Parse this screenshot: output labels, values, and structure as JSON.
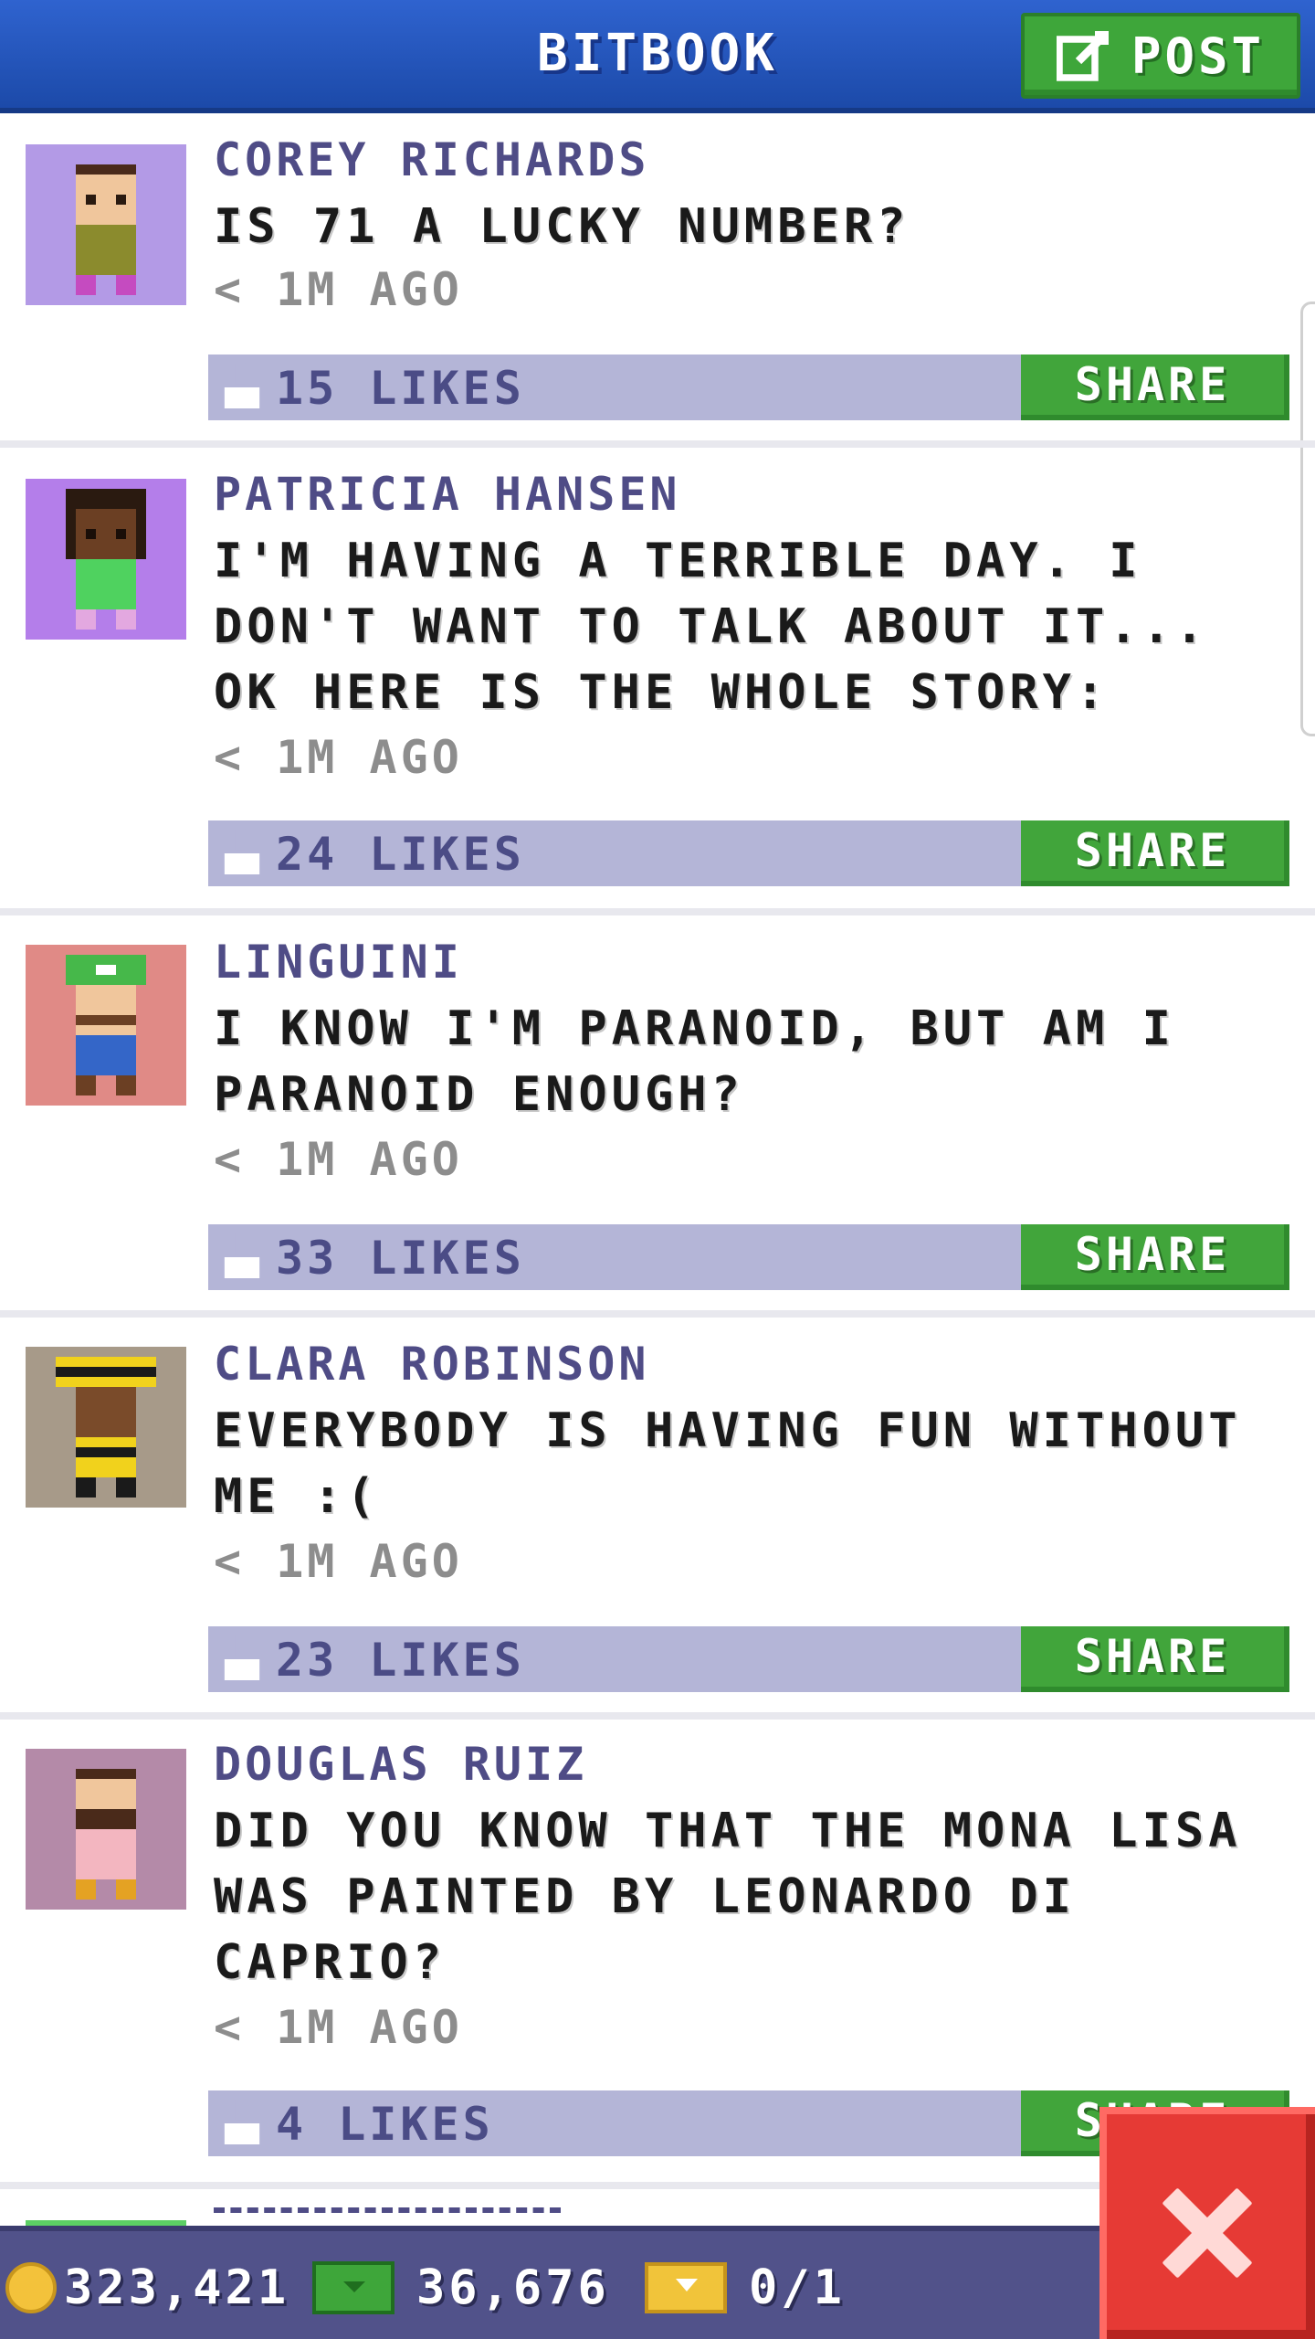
{
  "header": {
    "title": "BITBOOK",
    "post_label": "POST"
  },
  "posts": [
    {
      "author": "COREY RICHARDS",
      "content": "IS 71 A LUCKY NUMBER?",
      "time": "< 1M AGO",
      "likes": "15 LIKES",
      "share": "SHARE",
      "avatar_bg": "#b39ae6"
    },
    {
      "author": "PATRICIA HANSEN",
      "content": "I'M HAVING A TERRIBLE DAY. I DON'T WANT TO TALK ABOUT IT...  OK HERE IS THE WHOLE STORY:",
      "time": "< 1M AGO",
      "likes": "24 LIKES",
      "share": "SHARE",
      "avatar_bg": "#b47eea"
    },
    {
      "author": "LINGUINI",
      "content": "I KNOW I'M PARANOID, BUT AM I PARANOID ENOUGH?",
      "time": "< 1M AGO",
      "likes": "33 LIKES",
      "share": "SHARE",
      "avatar_bg": "#e08a86"
    },
    {
      "author": "CLARA ROBINSON",
      "content": "EVERYBODY IS HAVING FUN WITHOUT ME :(",
      "time": "< 1M AGO",
      "likes": "23 LIKES",
      "share": "SHARE",
      "avatar_bg": "#a79a89"
    },
    {
      "author": "DOUGLAS RUIZ",
      "content": "DID YOU KNOW THAT THE MONA LISA WAS PAINTED BY LEONARDO DI CAPRIO?",
      "time": "< 1M AGO",
      "likes": "4 LIKES",
      "share": "SHARE",
      "avatar_bg": "#b48aa8"
    }
  ],
  "footer": {
    "coins": "323,421",
    "bux": "36,676",
    "tickets": "0/1"
  },
  "colors": {
    "header": "#1c4aa9",
    "green": "#41a53b",
    "likes_bar": "#b4b5d7",
    "footer": "#51528a",
    "close": "#e63a35"
  },
  "icons": {
    "post": "edit-icon",
    "like": "thumbs-up-icon",
    "coin": "coin-icon",
    "bux": "bux-icon",
    "ticket": "ticket-icon",
    "close": "close-icon"
  }
}
